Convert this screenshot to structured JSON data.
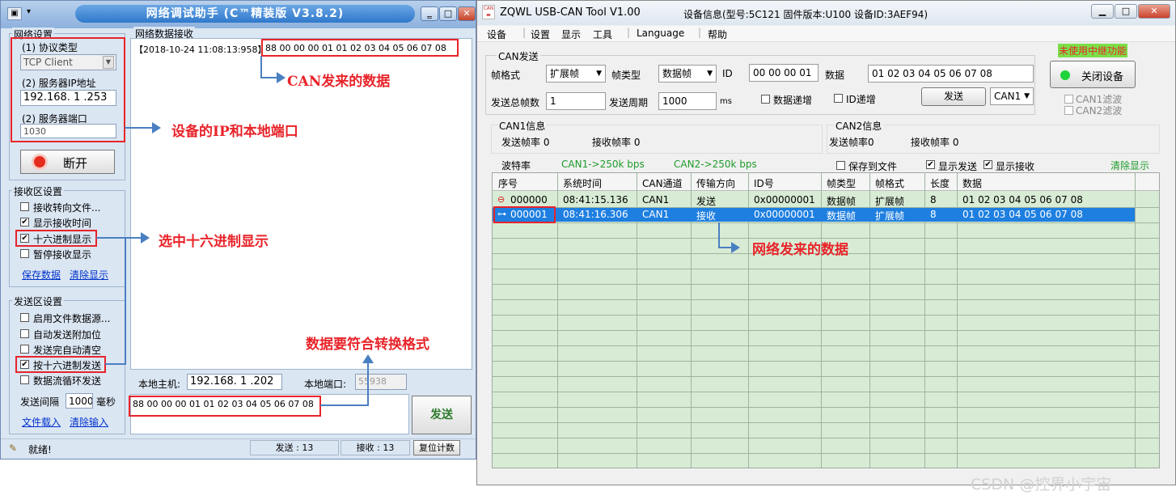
{
  "left_window": {
    "title": "网络调试助手 (C™精装版 V3.8.2)",
    "net_settings": {
      "group_label": "网络设置",
      "protocol_label": "(1) 协议类型",
      "protocol_value": "TCP Client",
      "server_ip_label": "(2) 服务器IP地址",
      "server_ip_value": "192.168. 1 .253",
      "server_port_label": "(2) 服务器端口",
      "server_port_value": "1030",
      "disconnect_label": "断开"
    },
    "recv_settings": {
      "group_label": "接收区设置",
      "options": [
        {
          "label": "接收转向文件...",
          "checked": false
        },
        {
          "label": "显示接收时间",
          "checked": true
        },
        {
          "label": "十六进制显示",
          "checked": true
        },
        {
          "label": "暂停接收显示",
          "checked": false
        }
      ],
      "save_link": "保存数据",
      "clear_link": "清除显示"
    },
    "send_settings": {
      "group_label": "发送区设置",
      "options": [
        {
          "label": "启用文件数据源...",
          "checked": false
        },
        {
          "label": "自动发送附加位",
          "checked": false
        },
        {
          "label": "发送完自动清空",
          "checked": false
        },
        {
          "label": "按十六进制发送",
          "checked": true
        },
        {
          "label": "数据流循环发送",
          "checked": false
        }
      ],
      "interval_label": "发送间隔",
      "interval_value": "1000",
      "interval_unit": "毫秒",
      "load_link": "文件载入",
      "clear_link": "清除输入"
    },
    "recv_area": {
      "group_label": "网络数据接收",
      "timestamp": "【2018-10-24 11:08:13:958】",
      "data": "88 00 00 00 01 01 02 03 04 05 06 07 08"
    },
    "local_host_label": "本地主机:",
    "local_host_value": "192.168. 1 .202",
    "local_port_label": "本地端口:",
    "local_port_value": "55938",
    "send_input": "88 00 00 00 01 01 02 03 04 05 06 07 08",
    "send_button": "发送",
    "status": {
      "ready": "就绪!",
      "sent": "发送 : 13",
      "recv": "接收 : 13",
      "reset": "复位计数"
    }
  },
  "right_window": {
    "app_name": "ZQWL USB-CAN Tool V1.00",
    "device_info": "设备信息(型号:5C121   固件版本:U100   设备ID:3AEF94)",
    "menu": [
      "设备",
      "设置",
      "显示",
      "工具",
      "Language",
      "帮助"
    ],
    "can_send": {
      "group_label": "CAN发送",
      "frame_format_label": "帧格式",
      "frame_format_value": "扩展帧",
      "frame_type_label": "帧类型",
      "frame_type_value": "数据帧",
      "id_label": "ID",
      "id_value": "00 00 00 01",
      "data_label": "数据",
      "data_value": "01 02 03 04 05 06 07 08",
      "total_frames_label": "发送总帧数",
      "total_frames_value": "1",
      "period_label": "发送周期",
      "period_value": "1000",
      "period_unit": "ms",
      "data_inc_label": "数据递增",
      "id_inc_label": "ID递增",
      "send_button": "发送",
      "channel_value": "CAN1"
    },
    "relay_status": "未使用中继功能",
    "close_device": "关闭设备",
    "can1_filter": "CAN1滤波",
    "can2_filter": "CAN2滤波",
    "can1_info": {
      "group_label": "CAN1信息",
      "send_rate": "发送帧率  0",
      "recv_rate": "接收帧率 0"
    },
    "can2_info": {
      "group_label": "CAN2信息",
      "send_rate": "发送帧率0",
      "recv_rate": "接收帧率  0"
    },
    "baud_label": "波特率",
    "baud_can1": "CAN1->250k   bps",
    "baud_can2": "CAN2->250k   bps",
    "save_file": "保存到文件",
    "show_send": "显示发送",
    "show_recv": "显示接收",
    "clear_display": "清除显示",
    "table": {
      "columns": [
        "序号",
        "系统时间",
        "CAN通道",
        "传输方向",
        "ID号",
        "帧类型",
        "帧格式",
        "长度",
        "数据"
      ],
      "rows": [
        [
          "000000",
          "08:41:15.136",
          "CAN1",
          "发送",
          "0x00000001",
          "数据帧",
          "扩展帧",
          "8",
          "01 02 03 04 05 06 07 08"
        ],
        [
          "000001",
          "08:41:16.306",
          "CAN1",
          "接收",
          "0x00000001",
          "数据帧",
          "扩展帧",
          "8",
          "01 02 03 04 05 06 07 08"
        ]
      ]
    }
  },
  "annotations": {
    "can_data": "CAN发来的数据",
    "device_ip_port": "设备的IP和本地端口",
    "hex_display": "选中十六进制显示",
    "data_format": "数据要符合转换格式",
    "network_data": "网络发来的数据"
  },
  "watermark": "CSDN @控界小宇宙",
  "colors": {
    "accent_blue": "#4a7fc1",
    "annotation_red": "#e8242a",
    "selected_row": "#1e7fe0",
    "grid_bg": "#d8ecd5"
  }
}
